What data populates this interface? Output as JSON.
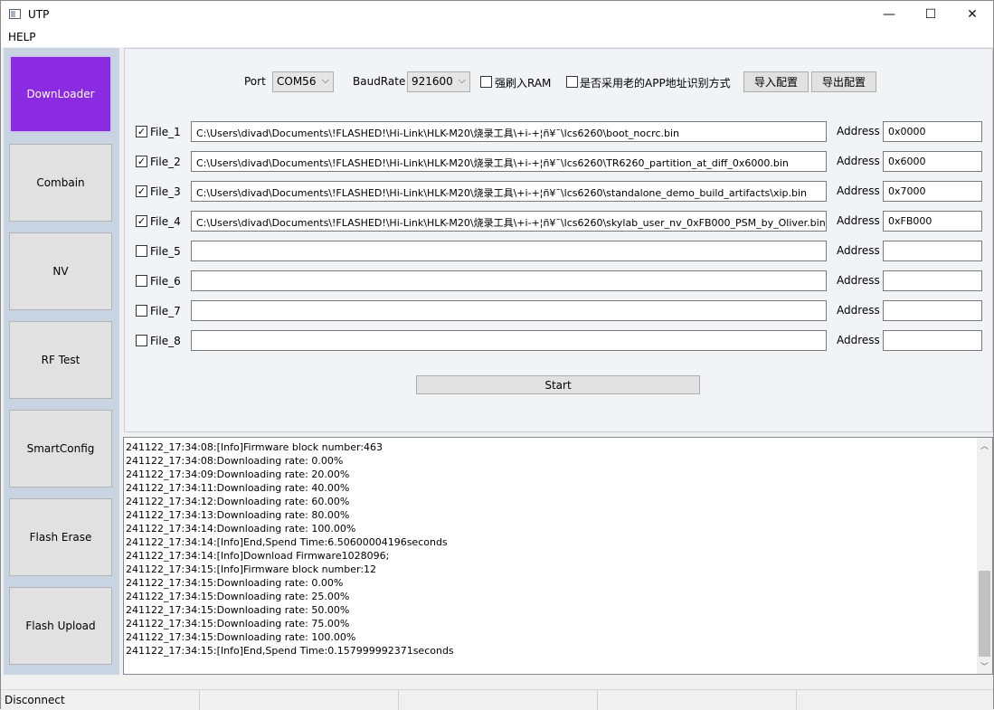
{
  "window": {
    "title": "UTP",
    "controls": {
      "minimize": "—",
      "maximize": "☐",
      "close": "✕"
    }
  },
  "menu": {
    "help": "HELP"
  },
  "sidebar": {
    "items": [
      {
        "label": "DownLoader",
        "active": true
      },
      {
        "label": "Combain"
      },
      {
        "label": "NV"
      },
      {
        "label": "RF Test"
      },
      {
        "label": "SmartConfig"
      },
      {
        "label": "Flash Erase"
      },
      {
        "label": "Flash Upload"
      }
    ],
    "active_color": "#8a2be2"
  },
  "settings": {
    "port_label": "Port",
    "port_value": "COM56",
    "baud_label": "BaudRate",
    "baud_value": "921600",
    "force_ram_label": "强刷入RAM",
    "force_ram_checked": false,
    "old_app_label": "是否采用老的APP地址识别方式",
    "old_app_checked": false,
    "import_button": "导入配置",
    "export_button": "导出配置"
  },
  "files": [
    {
      "label": "File_1",
      "checked": true,
      "path": "C:\\Users\\divad\\Documents\\!FLASHED!\\Hi-Link\\HLK-M20\\烧录工具\\+i-+¦ñ¥¯\\lcs6260\\boot_nocrc.bin",
      "address_label": "Address",
      "address": "0x0000"
    },
    {
      "label": "File_2",
      "checked": true,
      "path": "C:\\Users\\divad\\Documents\\!FLASHED!\\Hi-Link\\HLK-M20\\烧录工具\\+i-+¦ñ¥¯\\lcs6260\\TR6260_partition_at_diff_0x6000.bin",
      "address_label": "Address",
      "address": "0x6000"
    },
    {
      "label": "File_3",
      "checked": true,
      "path": "C:\\Users\\divad\\Documents\\!FLASHED!\\Hi-Link\\HLK-M20\\烧录工具\\+i-+¦ñ¥¯\\lcs6260\\standalone_demo_build_artifacts\\xip.bin",
      "address_label": "Address",
      "address": "0x7000"
    },
    {
      "label": "File_4",
      "checked": true,
      "path": "C:\\Users\\divad\\Documents\\!FLASHED!\\Hi-Link\\HLK-M20\\烧录工具\\+i-+¦ñ¥¯\\lcs6260\\skylab_user_nv_0xFB000_PSM_by_Oliver.bin",
      "address_label": "Address",
      "address": "0xFB000"
    },
    {
      "label": "File_5",
      "checked": false,
      "path": "",
      "address_label": "Address",
      "address": ""
    },
    {
      "label": "File_6",
      "checked": false,
      "path": "",
      "address_label": "Address",
      "address": ""
    },
    {
      "label": "File_7",
      "checked": false,
      "path": "",
      "address_label": "Address",
      "address": ""
    },
    {
      "label": "File_8",
      "checked": false,
      "path": "",
      "address_label": "Address",
      "address": ""
    }
  ],
  "start_button": "Start",
  "log": {
    "lines": [
      "241122_17:34:08:[Info]Firmware block number:463",
      "241122_17:34:08:Downloading rate: 0.00%",
      "241122_17:34:09:Downloading rate: 20.00%",
      "241122_17:34:11:Downloading rate: 40.00%",
      "241122_17:34:12:Downloading rate: 60.00%",
      "241122_17:34:13:Downloading rate: 80.00%",
      "241122_17:34:14:Downloading rate: 100.00%",
      "241122_17:34:14:[Info]End,Spend Time:6.50600004196seconds",
      "241122_17:34:14:[Info]Download Firmware1028096;",
      "241122_17:34:15:[Info]Firmware block number:12",
      "241122_17:34:15:Downloading rate: 0.00%",
      "241122_17:34:15:Downloading rate: 25.00%",
      "241122_17:34:15:Downloading rate: 50.00%",
      "241122_17:34:15:Downloading rate: 75.00%",
      "241122_17:34:15:Downloading rate: 100.00%",
      "241122_17:34:15:[Info]End,Spend Time:0.157999992371seconds"
    ]
  },
  "status": {
    "text": "Disconnect"
  }
}
